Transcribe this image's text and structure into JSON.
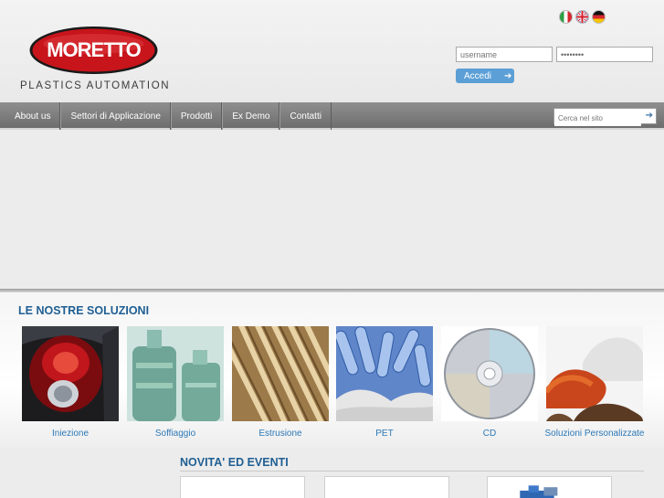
{
  "brand": {
    "logo_text": "MORETTO",
    "tagline": "PLASTICS AUTOMATION"
  },
  "languages": [
    {
      "icon": "italy-flag-icon"
    },
    {
      "icon": "uk-flag-icon"
    },
    {
      "icon": "germany-flag-icon"
    }
  ],
  "login": {
    "username_placeholder": "username",
    "password_value": "••••••••",
    "submit_label": "Accedi",
    "submit_icon": "arrow-right-icon"
  },
  "nav": {
    "items": [
      "About us",
      "Settori di Applicazione",
      "Prodotti",
      "Ex Demo",
      "Contatti"
    ],
    "search_placeholder": "Cerca nel sito",
    "search_icon": "arrow-right-icon"
  },
  "solutions": {
    "title": "LE NOSTRE SOLUZIONI",
    "items": [
      {
        "label": "Iniezione"
      },
      {
        "label": "Soffiaggio"
      },
      {
        "label": "Estrusione"
      },
      {
        "label": "PET"
      },
      {
        "label": "CD"
      },
      {
        "label": "Soluzioni Personalizzate"
      }
    ]
  },
  "news": {
    "title": "NOVITA' ED EVENTI"
  },
  "colors": {
    "accent_blue": "#1f5f93",
    "link_blue": "#2c78b7",
    "button_blue": "#5b9fd6",
    "logo_red": "#c8141b"
  }
}
